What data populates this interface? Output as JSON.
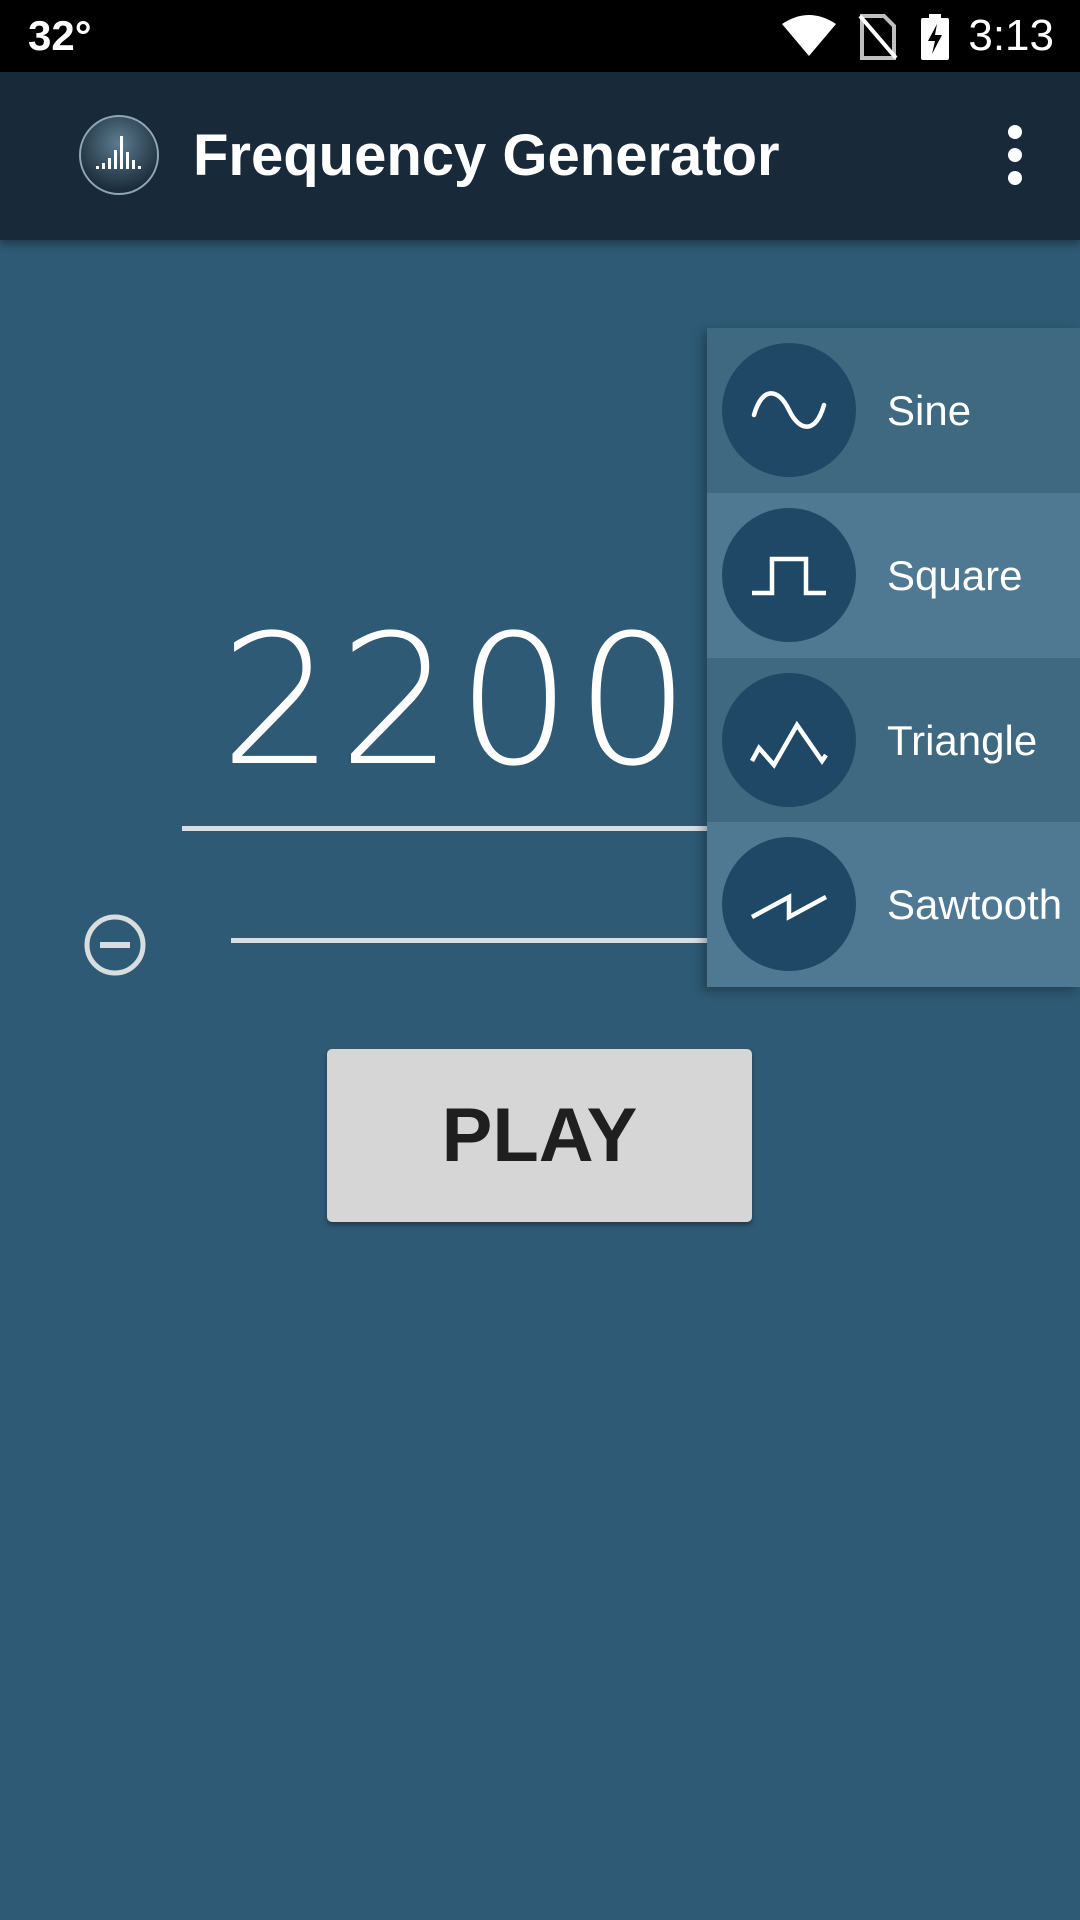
{
  "status_bar": {
    "temperature": "32°",
    "time": "3:13"
  },
  "app_bar": {
    "title": "Frequency Generator"
  },
  "frequency": {
    "value": "22000"
  },
  "play_button": {
    "label": "PLAY"
  },
  "waveform_menu": {
    "items": [
      {
        "label": "Sine",
        "icon": "sine-wave-icon",
        "selected": false
      },
      {
        "label": "Square",
        "icon": "square-wave-icon",
        "selected": true
      },
      {
        "label": "Triangle",
        "icon": "triangle-wave-icon",
        "selected": false
      },
      {
        "label": "Sawtooth",
        "icon": "sawtooth-wave-icon",
        "selected": false
      }
    ]
  },
  "colors": {
    "background": "#2e5a75",
    "app_bar": "#182a39",
    "menu_item": "#3f6881",
    "menu_item_selected": "#4f7892",
    "icon_circle": "#1e4865",
    "play_button": "#d6d6d6"
  }
}
